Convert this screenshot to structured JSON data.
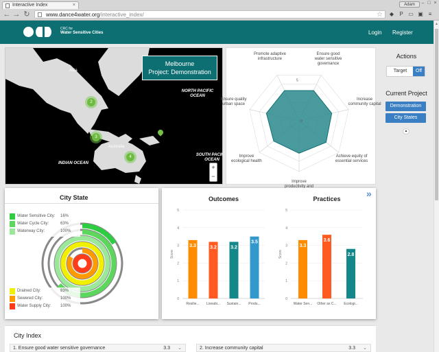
{
  "browser": {
    "tab_title": "Interactive Index",
    "url_host": "www.dance4water.org",
    "url_path": "/interactive_index/",
    "user": "Adam"
  },
  "header": {
    "brand_line1": "CRC for",
    "brand_line2": "Water Sensitive Cities",
    "login": "Login",
    "register": "Register"
  },
  "map": {
    "info_city": "Melbourne",
    "info_project": "Project: Demonstration",
    "labels": {
      "asia": "Asia",
      "australia": "Australia",
      "north_pacific": "NORTH PACIFIC OCEAN",
      "indian": "INDIAN OCEAN",
      "south_pacific": "SOUTH PACIFIC OCEAN"
    },
    "clusters": [
      "2",
      "3",
      "4"
    ],
    "zoom_in": "+",
    "zoom_out": "−"
  },
  "radar": {
    "axes": [
      "Ensure good water sensitive governance",
      "Increase community capital",
      "Achieve equity of essential services",
      "Improve productivity and resource efficiency",
      "Improve ecological health",
      "Ensure quality urban space",
      "Promote adaptive infrastructure"
    ],
    "values": [
      3.3,
      3.3,
      3.4,
      3.2,
      3.2,
      3.3,
      3.3
    ],
    "max": 5,
    "ticks": [
      "0",
      "5"
    ]
  },
  "side": {
    "actions_title": "Actions",
    "target_label": "Target",
    "off_label": "Off",
    "current_project_title": "Current Project",
    "demo_btn": "Demonstration",
    "states_btn": "City States",
    "caret": "▲"
  },
  "city_state": {
    "title": "City State",
    "legend_top": [
      {
        "name": "Water Sensitive City:",
        "pct": "16%",
        "color": "#2ecc40"
      },
      {
        "name": "Water Cycle City:",
        "pct": "63%",
        "color": "#5cd65c"
      },
      {
        "name": "Waterway City:",
        "pct": "100%",
        "color": "#9be89b"
      }
    ],
    "legend_bottom": [
      {
        "name": "Drained City:",
        "pct": "83%",
        "color": "#f0f000"
      },
      {
        "name": "Sewered City:",
        "pct": "100%",
        "color": "#ff9a00"
      },
      {
        "name": "Water Supply City:",
        "pct": "100%",
        "color": "#ff3b1a"
      }
    ],
    "ring_fractions": [
      1.0,
      0.83,
      1.0,
      1.0,
      0.63,
      0.16
    ]
  },
  "chart_data": [
    {
      "type": "bar",
      "title": "Outcomes",
      "ylabel": "Score",
      "ylim": [
        0,
        5
      ],
      "yticks": [
        "0",
        "1",
        "2",
        "3",
        "4",
        "5"
      ],
      "categories": [
        "Resilie...",
        "Liveabi...",
        "Sustain...",
        "Produ..."
      ],
      "values": [
        3.3,
        3.2,
        3.2,
        3.5
      ],
      "labels": [
        "3.3",
        "3.2",
        "3.2",
        "3.5"
      ],
      "colors": [
        "#ff8c00",
        "#ff5a1f",
        "#14878a",
        "#3399cc"
      ]
    },
    {
      "type": "bar",
      "title": "Practices",
      "ylabel": "Score",
      "ylim": [
        0,
        5
      ],
      "yticks": [
        "0",
        "1",
        "2",
        "3",
        "4",
        "5"
      ],
      "categories": [
        "Water Sen...",
        "Other as C...",
        "Ecologi..."
      ],
      "values": [
        3.3,
        3.6,
        2.8
      ],
      "labels": [
        "3.3",
        "3.6",
        "2.8"
      ],
      "colors": [
        "#ff8c00",
        "#ff5a1f",
        "#14878a"
      ]
    }
  ],
  "city_index": {
    "title": "City Index",
    "rows": [
      {
        "label": "1. Ensure good water sensitive governance",
        "value": "3.3"
      },
      {
        "label": "2. Increase community capital",
        "value": "3.3"
      }
    ]
  }
}
